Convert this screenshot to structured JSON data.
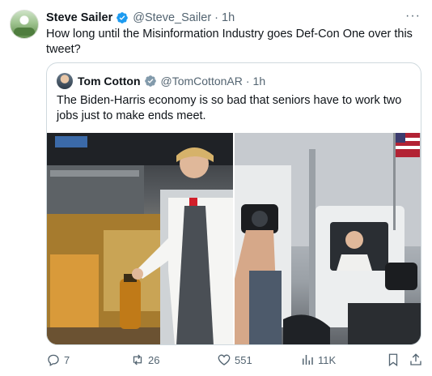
{
  "tweet": {
    "author_name": "Steve Sailer",
    "author_handle": "@Steve_Sailer",
    "separator": "·",
    "time": "1h",
    "more_label": "···",
    "text": "How long until the Misinformation Industry goes Def-Con One over this tweet?",
    "avatar_icon": "avatar-photo",
    "verified_icon": "verified-badge-icon",
    "accent_color": "#1d9bf0"
  },
  "quote": {
    "author_name": "Tom Cotton",
    "author_handle": "@TomCottonAR",
    "separator": "·",
    "time": "1h",
    "text": "The Biden-Harris economy is so bad that seniors have to work two jobs just to make ends meet.",
    "photos": [
      {
        "name": "fast-food-fryer-photo"
      },
      {
        "name": "garbage-truck-press-photo"
      }
    ]
  },
  "actions": {
    "replies": "7",
    "reposts": "26",
    "likes": "551",
    "views": "11K"
  }
}
